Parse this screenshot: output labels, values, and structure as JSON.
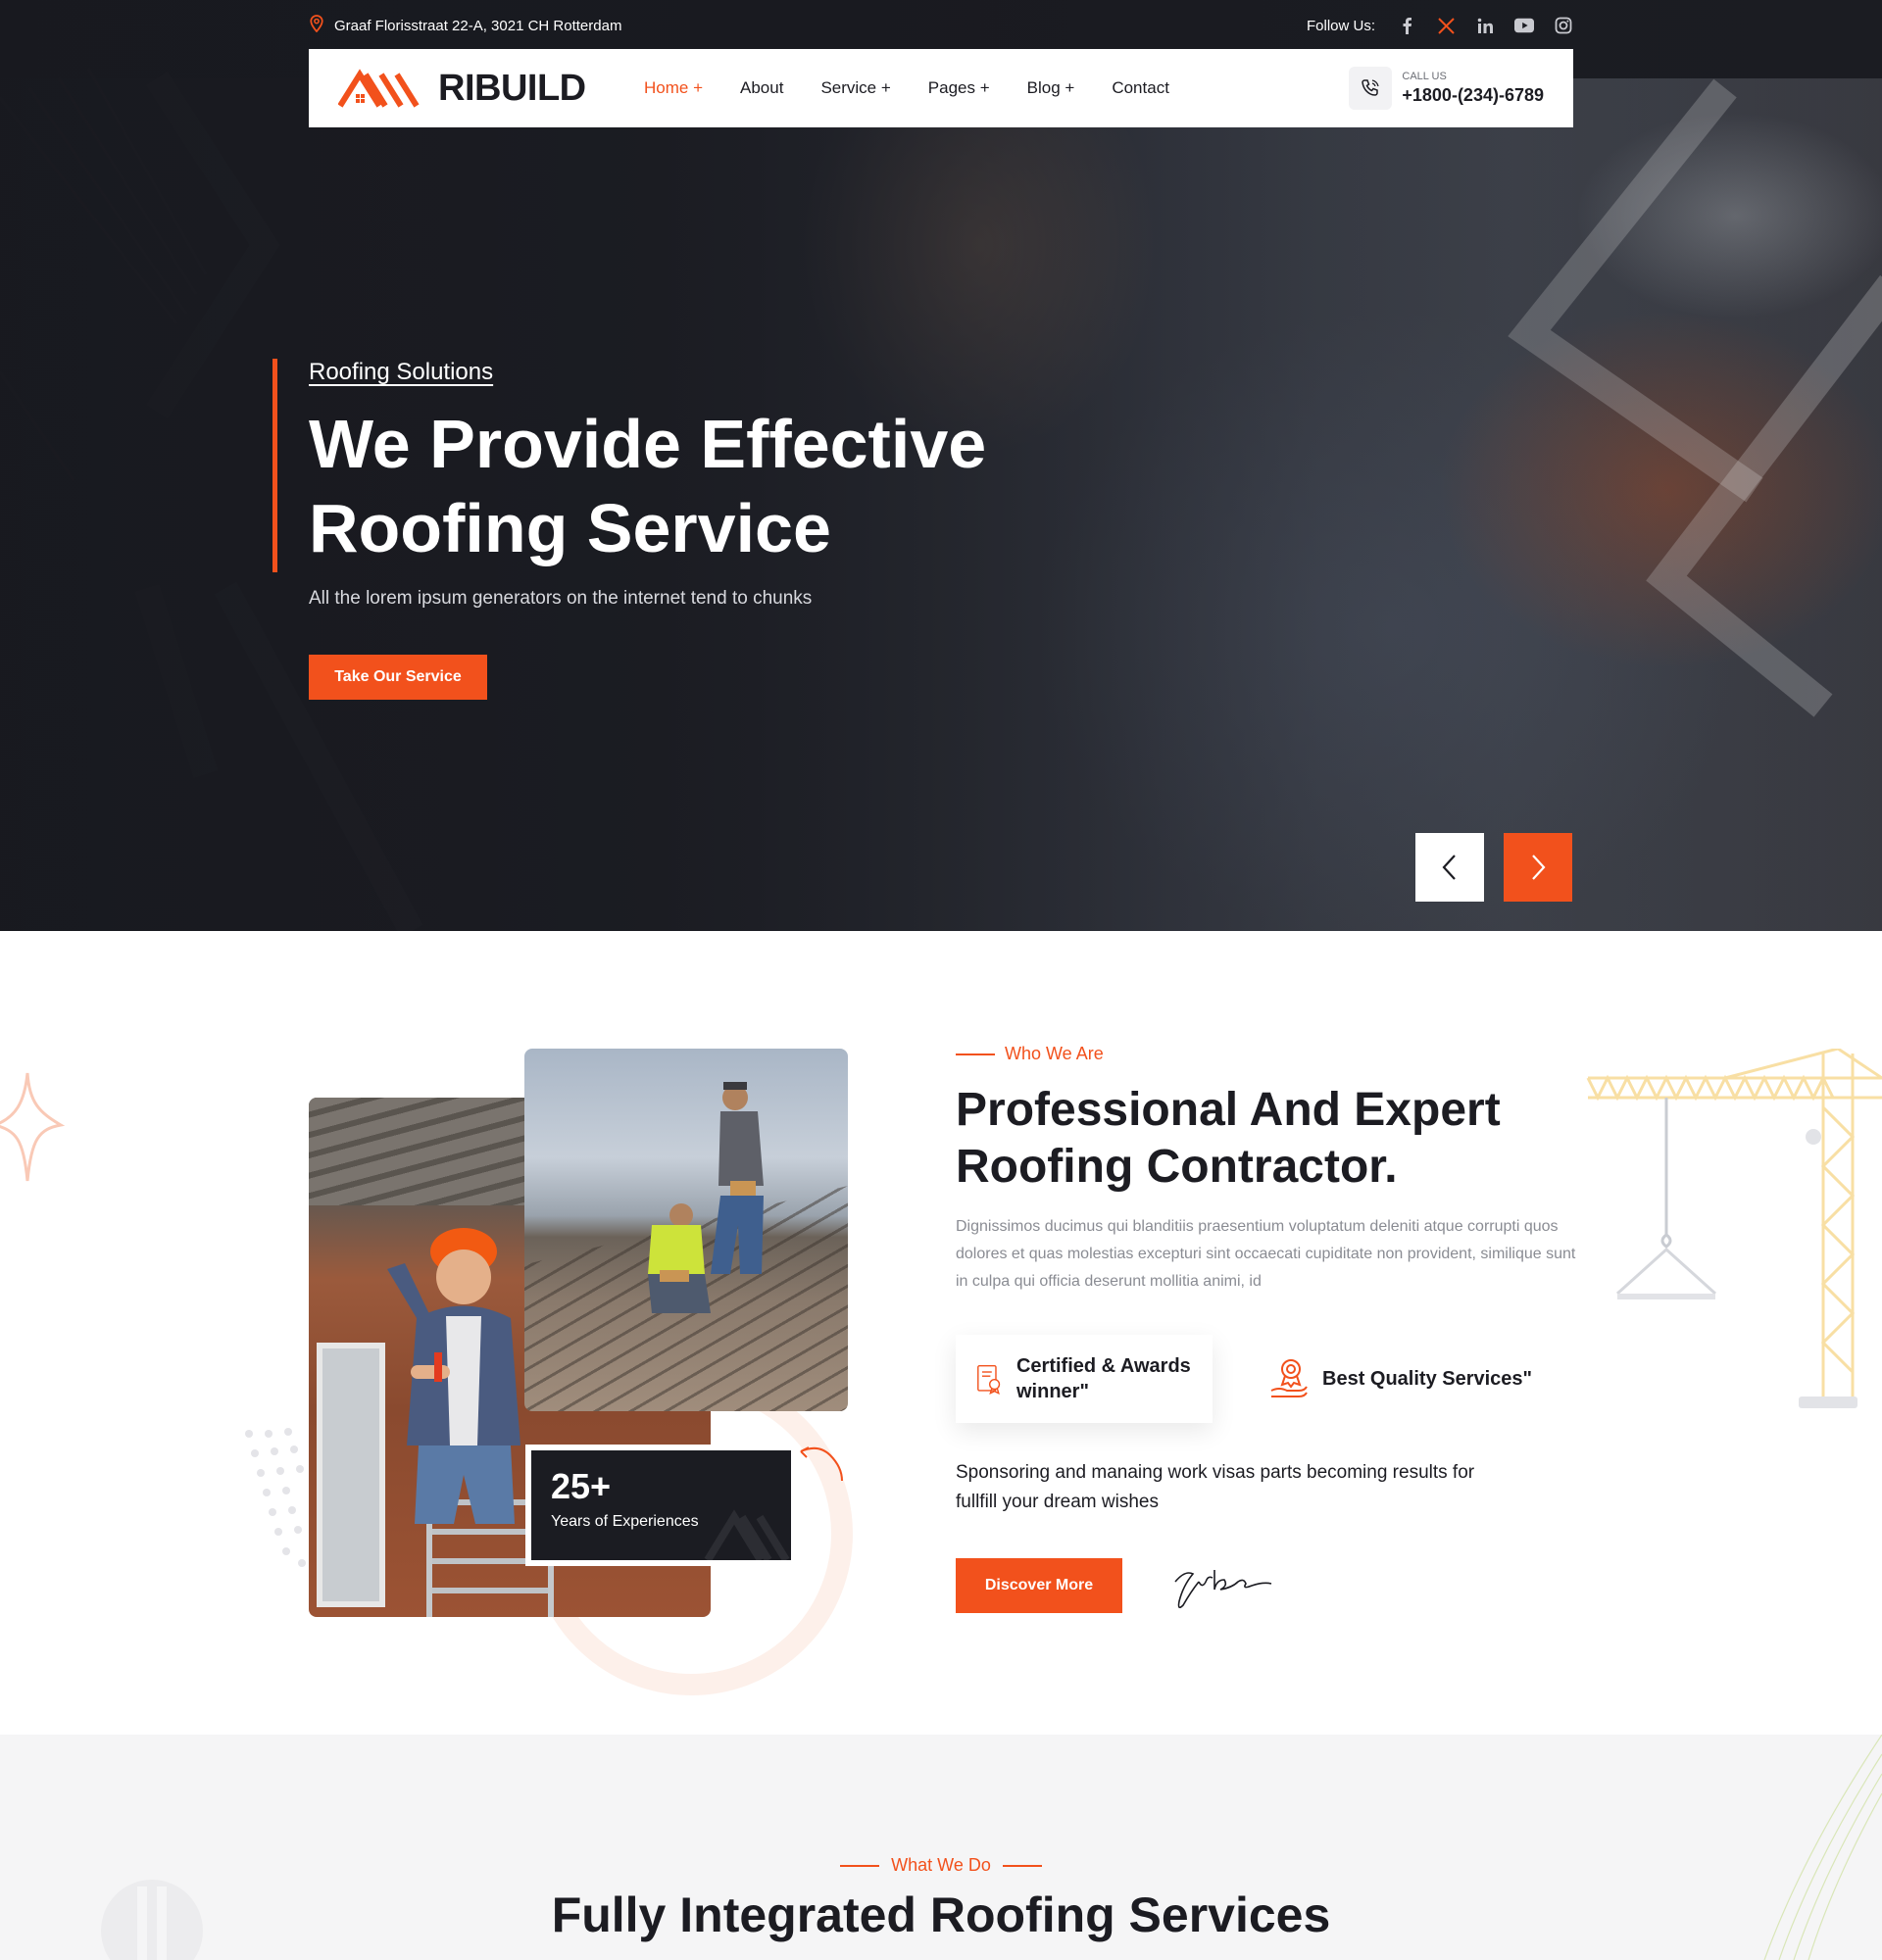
{
  "topbar": {
    "address": "Graaf Florisstraat 22-A, 3021 CH Rotterdam",
    "follow_label": "Follow Us:",
    "social": [
      "facebook-icon",
      "x-icon",
      "linkedin-icon",
      "youtube-icon",
      "instagram-icon"
    ]
  },
  "header": {
    "logo_text": "RIBUILD",
    "nav": [
      "Home +",
      "About",
      "Service +",
      "Pages +",
      "Blog +",
      "Contact"
    ],
    "call_label": "CALL US",
    "call_number": "+1800-(234)-6789"
  },
  "hero": {
    "subtitle": "Roofing Solutions",
    "title": "We Provide Effective Roofing Service",
    "description": "All the lorem ipsum generators on the internet tend to chunks",
    "cta": "Take Our Service"
  },
  "about": {
    "tag": "Who We Are",
    "title": "Professional And Expert Roofing Contractor.",
    "description": "Dignissimos ducimus qui blanditiis praesentium voluptatum deleniti atque corrupti quos dolores et quas molestias excepturi sint occaecati cupiditate non provident, similique sunt in culpa qui officia deserunt mollitia animi, id",
    "experience_number": "25+",
    "experience_label": "Years of Experiences",
    "features": [
      {
        "label": "Certified & Awards winner\"",
        "icon": "certificate-icon"
      },
      {
        "label": "Best Quality Services\"",
        "icon": "quality-badge-icon"
      }
    ],
    "quote": "Sponsoring and manaing work visas parts becoming results for fullfill your dream wishes",
    "cta": "Discover More"
  },
  "services": {
    "tag": "What We Do",
    "title": "Fully Integrated Roofing Services"
  },
  "colors": {
    "accent": "#f2511c",
    "dark": "#1b1c22",
    "light_bg": "#f5f5f6"
  }
}
